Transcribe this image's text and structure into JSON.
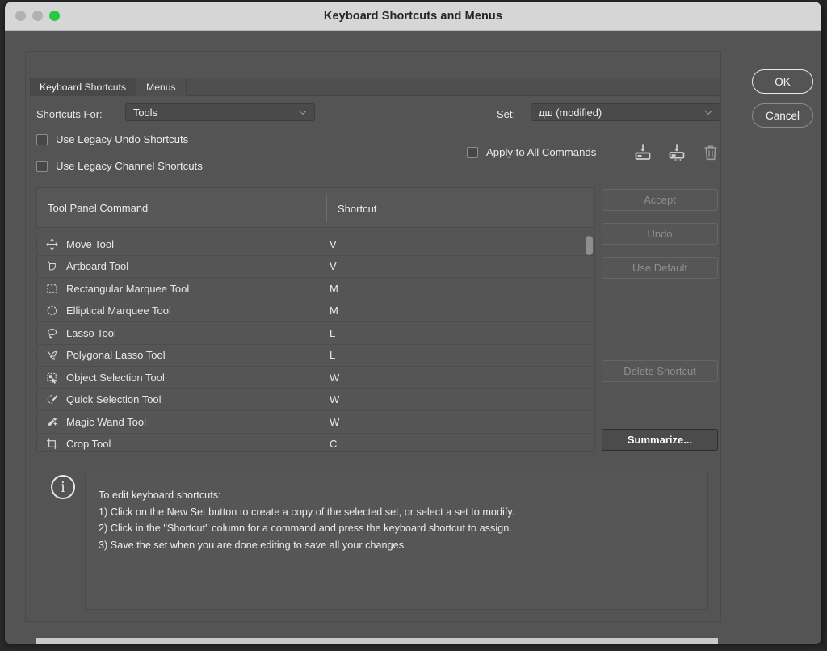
{
  "window": {
    "title": "Keyboard Shortcuts and Menus",
    "traffic_lights": [
      "close-gray",
      "minimize-gray",
      "maximize-green"
    ]
  },
  "tabs": [
    {
      "label": "Keyboard Shortcuts",
      "active": true
    },
    {
      "label": "Menus",
      "active": false
    }
  ],
  "controls": {
    "shortcuts_for_label": "Shortcuts For:",
    "shortcuts_for_value": "Tools",
    "set_label": "Set:",
    "set_value": "дш (modified)",
    "legacy_undo_label": "Use Legacy Undo Shortcuts",
    "legacy_undo_checked": false,
    "legacy_channel_label": "Use Legacy Channel Shortcuts",
    "legacy_channel_checked": false,
    "apply_all_label": "Apply to All Commands",
    "apply_all_checked": false,
    "icons": [
      "save-set-icon",
      "save-set-as-icon",
      "delete-set-icon"
    ]
  },
  "table": {
    "headers": {
      "command": "Tool Panel Command",
      "shortcut": "Shortcut"
    },
    "rows": [
      {
        "icon": "move-tool-icon",
        "name": "Move Tool",
        "key": "V"
      },
      {
        "icon": "artboard-tool-icon",
        "name": "Artboard Tool",
        "key": "V"
      },
      {
        "icon": "rectangular-marquee-tool-icon",
        "name": "Rectangular Marquee Tool",
        "key": "M"
      },
      {
        "icon": "elliptical-marquee-tool-icon",
        "name": "Elliptical Marquee Tool",
        "key": "M"
      },
      {
        "icon": "lasso-tool-icon",
        "name": "Lasso Tool",
        "key": "L"
      },
      {
        "icon": "polygonal-lasso-tool-icon",
        "name": "Polygonal Lasso Tool",
        "key": "L"
      },
      {
        "icon": "object-selection-tool-icon",
        "name": "Object Selection Tool",
        "key": "W"
      },
      {
        "icon": "quick-selection-tool-icon",
        "name": "Quick Selection Tool",
        "key": "W"
      },
      {
        "icon": "magic-wand-tool-icon",
        "name": "Magic Wand Tool",
        "key": "W"
      },
      {
        "icon": "crop-tool-icon",
        "name": "Crop Tool",
        "key": "C"
      }
    ]
  },
  "side_buttons": {
    "accept": "Accept",
    "undo": "Undo",
    "use_default": "Use Default",
    "delete_shortcut": "Delete Shortcut",
    "summarize": "Summarize..."
  },
  "info": {
    "icon": "info-icon",
    "lines": [
      "To edit keyboard shortcuts:",
      "1) Click on the New Set button to create a copy of the selected set, or select a set to modify.",
      "2) Click in the \"Shortcut\" column for a command and press the keyboard shortcut to assign.",
      "3) Save the set when you are done editing to save all your changes."
    ]
  },
  "dialog_buttons": {
    "ok": "OK",
    "cancel": "Cancel"
  },
  "colors": {
    "window_bg": "#545454",
    "titlebar_bg": "#d6d6d6",
    "accent_green": "#28c840",
    "text": "#ececec",
    "disabled_text": "#8f8f8f"
  }
}
